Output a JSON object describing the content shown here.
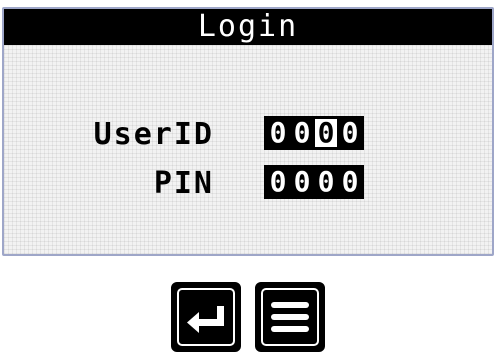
{
  "title": "Login",
  "fields": [
    {
      "label": "UserID",
      "digits": [
        "0",
        "0",
        "0",
        "0"
      ],
      "cursor_index": 2
    },
    {
      "label": "PIN",
      "digits": [
        "0",
        "0",
        "0",
        "0"
      ]
    }
  ],
  "colors": {
    "lcd_background": "#f2f2f2",
    "lcd_border": "#9ea6c8",
    "ink": "#000000"
  },
  "buttons": [
    {
      "icon": "enter-icon"
    },
    {
      "icon": "menu-icon"
    }
  ]
}
